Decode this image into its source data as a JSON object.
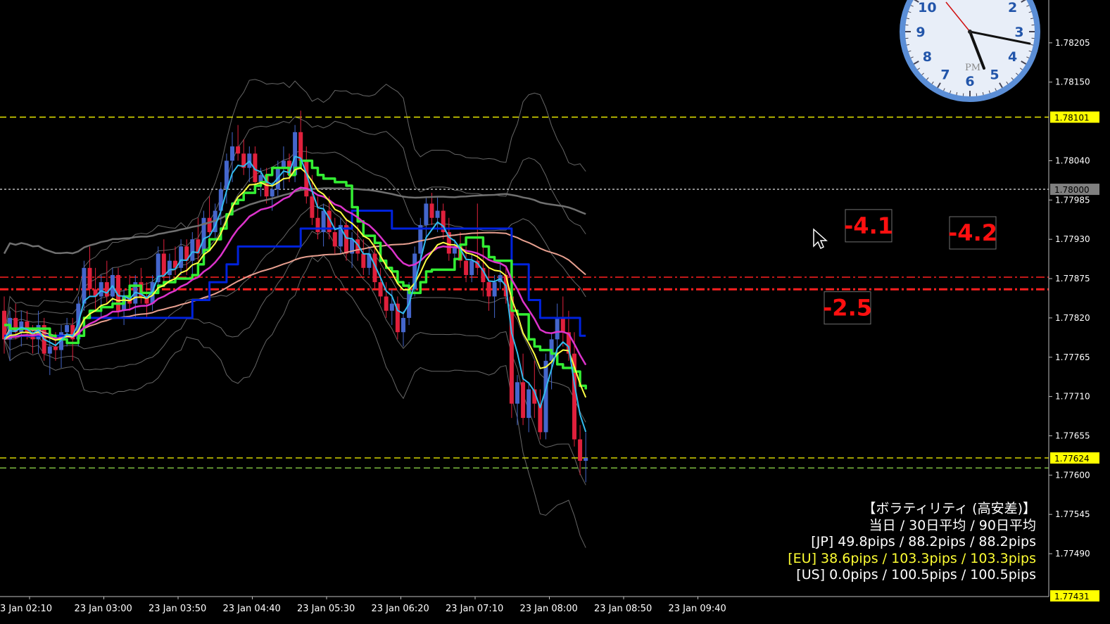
{
  "chart_data": {
    "type": "candlestick",
    "instrument_note": "",
    "ylim": [
      1.7743,
      1.7826
    ],
    "y_ticks": [
      "1.78205",
      "1.78150",
      "1.78040",
      "1.77985",
      "1.77930",
      "1.77875",
      "1.77820",
      "1.77765",
      "1.77710",
      "1.77655",
      "1.77600",
      "1.77545",
      "1.77490"
    ],
    "x_ticks": [
      "3 Jan 02:10",
      "23 Jan 03:00",
      "23 Jan 03:50",
      "23 Jan 04:40",
      "23 Jan 05:30",
      "23 Jan 06:20",
      "23 Jan 07:10",
      "23 Jan 08:00",
      "23 Jan 08:50",
      "23 Jan 09:40"
    ],
    "price_labels": [
      {
        "value": "1.78101",
        "bg": "#ffff00",
        "fg": "#000000"
      },
      {
        "value": "1.78000",
        "bg": "#808080",
        "fg": "#000000"
      },
      {
        "value": "1.77624",
        "bg": "#ffff00",
        "fg": "#000000"
      },
      {
        "value": "1.77431",
        "bg": "#ffff00",
        "fg": "#000000"
      }
    ],
    "horizontal_lines": [
      {
        "price": 1.78101,
        "color": "#e6e600",
        "style": "dash"
      },
      {
        "price": 1.78,
        "color": "#cccccc",
        "style": "dot"
      },
      {
        "price": 1.77877,
        "color": "#ff2020",
        "style": "dashdot"
      },
      {
        "price": 1.7786,
        "color": "#ff2020",
        "style": "dashdot-thick"
      },
      {
        "price": 1.77624,
        "color": "#e6e600",
        "style": "dash"
      },
      {
        "price": 1.7761,
        "color": "#88cc44",
        "style": "dash"
      }
    ],
    "candles": [
      [
        1.7783,
        1.7785,
        1.7777,
        1.7779
      ],
      [
        1.7779,
        1.7783,
        1.7776,
        1.7782
      ],
      [
        1.7782,
        1.7784,
        1.7779,
        1.778
      ],
      [
        1.778,
        1.7783,
        1.7778,
        1.77815
      ],
      [
        1.77815,
        1.7783,
        1.7779,
        1.778
      ],
      [
        1.778,
        1.7781,
        1.7777,
        1.7779
      ],
      [
        1.7779,
        1.7783,
        1.7777,
        1.7781
      ],
      [
        1.7781,
        1.7782,
        1.7776,
        1.7777
      ],
      [
        1.7777,
        1.778,
        1.7774,
        1.7778
      ],
      [
        1.7778,
        1.778,
        1.7776,
        1.77775
      ],
      [
        1.77775,
        1.7781,
        1.7775,
        1.778
      ],
      [
        1.778,
        1.7782,
        1.7778,
        1.7781
      ],
      [
        1.7781,
        1.7782,
        1.7776,
        1.7779
      ],
      [
        1.7779,
        1.7785,
        1.7778,
        1.7784
      ],
      [
        1.7784,
        1.779,
        1.7783,
        1.7789
      ],
      [
        1.7789,
        1.7792,
        1.7785,
        1.7786
      ],
      [
        1.7786,
        1.7789,
        1.7783,
        1.7785
      ],
      [
        1.7785,
        1.7788,
        1.7782,
        1.7787
      ],
      [
        1.7787,
        1.779,
        1.7784,
        1.7785
      ],
      [
        1.7785,
        1.7789,
        1.7784,
        1.7788
      ],
      [
        1.7788,
        1.7789,
        1.7782,
        1.7783
      ],
      [
        1.7783,
        1.7786,
        1.7781,
        1.7785
      ],
      [
        1.7785,
        1.7788,
        1.7783,
        1.7784
      ],
      [
        1.7784,
        1.7788,
        1.7782,
        1.7787
      ],
      [
        1.7787,
        1.7789,
        1.7784,
        1.7785
      ],
      [
        1.7785,
        1.7787,
        1.7782,
        1.7784
      ],
      [
        1.7784,
        1.7788,
        1.7783,
        1.7787
      ],
      [
        1.7787,
        1.7792,
        1.7786,
        1.7791
      ],
      [
        1.7791,
        1.7793,
        1.7787,
        1.7788
      ],
      [
        1.7788,
        1.7791,
        1.7787,
        1.779
      ],
      [
        1.779,
        1.7792,
        1.7788,
        1.7789
      ],
      [
        1.7789,
        1.7793,
        1.7788,
        1.7792
      ],
      [
        1.7792,
        1.7793,
        1.7788,
        1.779
      ],
      [
        1.779,
        1.7794,
        1.7788,
        1.7793
      ],
      [
        1.7793,
        1.7796,
        1.779,
        1.7791
      ],
      [
        1.7791,
        1.7797,
        1.779,
        1.7796
      ],
      [
        1.7796,
        1.7799,
        1.7792,
        1.7794
      ],
      [
        1.7794,
        1.7798,
        1.7793,
        1.7797
      ],
      [
        1.7797,
        1.7801,
        1.7795,
        1.78
      ],
      [
        1.78,
        1.7805,
        1.7798,
        1.7804
      ],
      [
        1.7804,
        1.7808,
        1.7801,
        1.7806
      ],
      [
        1.7806,
        1.7809,
        1.7804,
        1.7805
      ],
      [
        1.7805,
        1.7807,
        1.7802,
        1.7803
      ],
      [
        1.7803,
        1.7806,
        1.7801,
        1.7805
      ],
      [
        1.7805,
        1.7806,
        1.78,
        1.7801
      ],
      [
        1.7801,
        1.7803,
        1.7799,
        1.7802
      ],
      [
        1.7802,
        1.7803,
        1.7798,
        1.7799
      ],
      [
        1.7799,
        1.7801,
        1.7797,
        1.78
      ],
      [
        1.78,
        1.7804,
        1.7799,
        1.7803
      ],
      [
        1.7803,
        1.7806,
        1.78,
        1.7804
      ],
      [
        1.7804,
        1.7805,
        1.7801,
        1.7802
      ],
      [
        1.7802,
        1.7809,
        1.7801,
        1.7808
      ],
      [
        1.7808,
        1.7811,
        1.7803,
        1.7804
      ],
      [
        1.7804,
        1.7806,
        1.7798,
        1.7799
      ],
      [
        1.7799,
        1.7802,
        1.7795,
        1.7796
      ],
      [
        1.7796,
        1.7799,
        1.7793,
        1.7794
      ],
      [
        1.7794,
        1.7798,
        1.7792,
        1.7797
      ],
      [
        1.7797,
        1.7799,
        1.7793,
        1.7794
      ],
      [
        1.7794,
        1.7796,
        1.7791,
        1.7792
      ],
      [
        1.7792,
        1.7796,
        1.7791,
        1.7795
      ],
      [
        1.7795,
        1.7796,
        1.779,
        1.7791
      ],
      [
        1.7791,
        1.7794,
        1.7789,
        1.7793
      ],
      [
        1.7793,
        1.7795,
        1.779,
        1.7791
      ],
      [
        1.7791,
        1.7793,
        1.7788,
        1.7789
      ],
      [
        1.7789,
        1.7792,
        1.7788,
        1.7791
      ],
      [
        1.7791,
        1.7793,
        1.7786,
        1.7787
      ],
      [
        1.7787,
        1.7789,
        1.7784,
        1.7785
      ],
      [
        1.7785,
        1.7787,
        1.7782,
        1.7783
      ],
      [
        1.7783,
        1.7786,
        1.7781,
        1.7784
      ],
      [
        1.7784,
        1.7785,
        1.7779,
        1.778
      ],
      [
        1.778,
        1.7783,
        1.7778,
        1.7782
      ],
      [
        1.7782,
        1.7787,
        1.7781,
        1.7786
      ],
      [
        1.7786,
        1.7792,
        1.7785,
        1.7791
      ],
      [
        1.7791,
        1.7796,
        1.779,
        1.7795
      ],
      [
        1.7795,
        1.7799,
        1.7793,
        1.7798
      ],
      [
        1.7798,
        1.77995,
        1.7795,
        1.7796
      ],
      [
        1.7796,
        1.7799,
        1.7794,
        1.7797
      ],
      [
        1.7797,
        1.7798,
        1.7793,
        1.7794
      ],
      [
        1.7794,
        1.7796,
        1.779,
        1.7791
      ],
      [
        1.7791,
        1.7793,
        1.7789,
        1.7792
      ],
      [
        1.7792,
        1.7794,
        1.7789,
        1.779
      ],
      [
        1.779,
        1.7792,
        1.7787,
        1.7788
      ],
      [
        1.7788,
        1.7791,
        1.7787,
        1.779
      ],
      [
        1.779,
        1.7798,
        1.7788,
        1.7789
      ],
      [
        1.7789,
        1.7792,
        1.7785,
        1.7787
      ],
      [
        1.7787,
        1.7789,
        1.7783,
        1.7785
      ],
      [
        1.7785,
        1.7788,
        1.7782,
        1.7787
      ],
      [
        1.7787,
        1.779,
        1.7786,
        1.7788
      ],
      [
        1.7788,
        1.7789,
        1.7784,
        1.7785
      ],
      [
        1.7785,
        1.7786,
        1.7768,
        1.777
      ],
      [
        1.777,
        1.7774,
        1.7767,
        1.7773
      ],
      [
        1.7773,
        1.7777,
        1.7767,
        1.7768
      ],
      [
        1.7768,
        1.7773,
        1.7766,
        1.7772
      ],
      [
        1.7772,
        1.7776,
        1.7768,
        1.777
      ],
      [
        1.777,
        1.7772,
        1.7765,
        1.7766
      ],
      [
        1.7766,
        1.7777,
        1.7765,
        1.7776
      ],
      [
        1.7776,
        1.778,
        1.7772,
        1.7779
      ],
      [
        1.7779,
        1.7784,
        1.7776,
        1.7782
      ],
      [
        1.7782,
        1.7785,
        1.7778,
        1.778
      ],
      [
        1.778,
        1.7783,
        1.7776,
        1.7777
      ],
      [
        1.7777,
        1.778,
        1.7764,
        1.7765
      ],
      [
        1.7765,
        1.7767,
        1.776,
        1.7762
      ],
      [
        1.7762,
        1.7766,
        1.7759,
        1.77624
      ]
    ],
    "annotations": [
      {
        "text": "-4.1",
        "price": 1.7795
      },
      {
        "text": "-4.2",
        "price": 1.7794
      },
      {
        "text": "-2.5",
        "price": 1.77835
      }
    ],
    "clock": {
      "numerals": [
        "10",
        "9",
        "8",
        "7",
        "6",
        "5",
        "4",
        "3",
        "2"
      ],
      "period": "PM"
    }
  },
  "volatility": {
    "title": "【ボラティリティ (高安差)】",
    "header": "当日 / 30日平均 / 90日平均",
    "jp": "[JP] 49.8pips / 88.2pips / 88.2pips",
    "eu": "[EU] 38.6pips / 103.3pips / 103.3pips",
    "us": "[US] 0.0pips / 100.5pips / 100.5pips"
  },
  "colors": {
    "bull": "#4466cc",
    "bear": "#e0203c",
    "ma_cyan": "#33bbee",
    "ma_yellow": "#ffff44",
    "ma_magenta": "#dd33cc",
    "ma_green": "#33ee33",
    "ma_salmon": "#e8a090",
    "ma_blue": "#0022dd",
    "ma_gray": "#707070",
    "bands": "#888888",
    "axis": "#c0c0c0"
  }
}
